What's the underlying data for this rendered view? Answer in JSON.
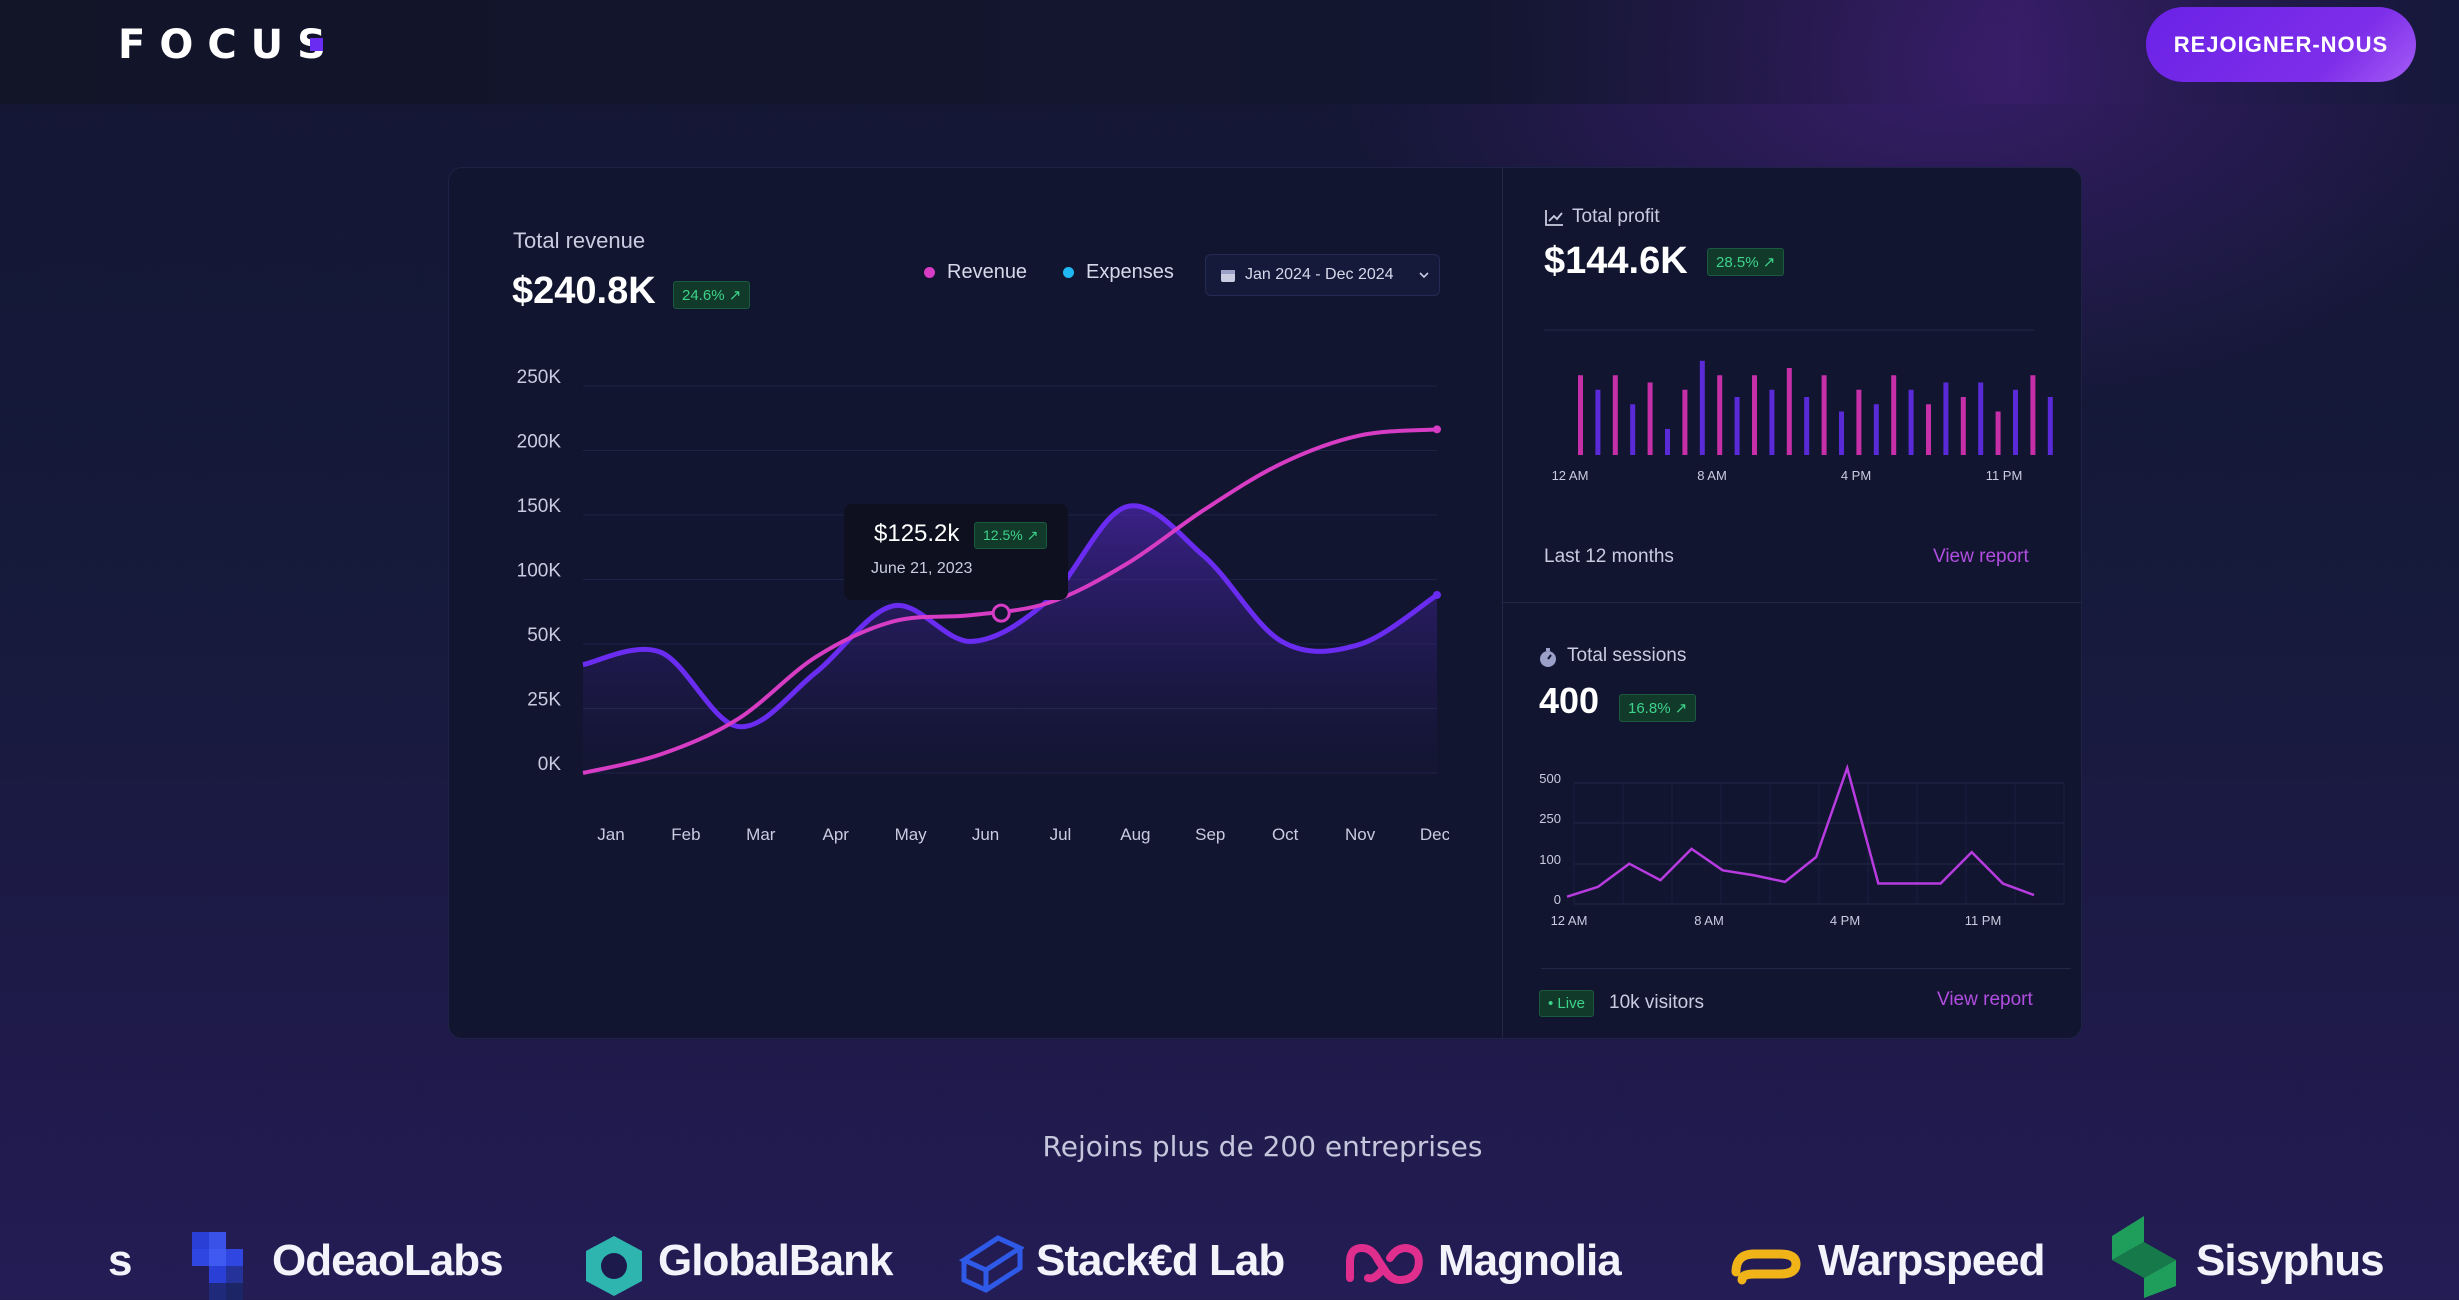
{
  "header": {
    "logo_text": "FOCUS",
    "cta_label": "REJOIGNER-NOUS"
  },
  "revenue": {
    "title": "Total revenue",
    "value": "$240.8K",
    "badge": "24.6% ↗",
    "legend": [
      {
        "name": "Revenue",
        "color": "#d63cc4"
      },
      {
        "name": "Expenses",
        "color": "#1fb8f2"
      }
    ],
    "date_range": "Jan 2024 - Dec 2024",
    "tooltip": {
      "value": "$125.2k",
      "badge": "12.5% ↗",
      "date": "June 21, 2023"
    }
  },
  "profit": {
    "title": "Total profit",
    "value": "$144.6K",
    "badge": "28.5% ↗",
    "footer": "Last 12 months",
    "link": "View report"
  },
  "sessions": {
    "title": "Total sessions",
    "value": "400",
    "badge": "16.8% ↗",
    "live_label": "• Live",
    "visitors": "10k visitors",
    "link": "View report"
  },
  "clients": {
    "subtitle": "Rejoins plus de 200 entreprises",
    "brands": [
      "s",
      "OdeaoLabs",
      "GlobalBank",
      "Stack€d Lab",
      "Magnolia",
      "Warpspeed",
      "Sisyphus"
    ]
  },
  "chart_data": [
    {
      "type": "line",
      "title": "",
      "categories": [
        "Jan",
        "Feb",
        "Mar",
        "Apr",
        "May",
        "Jun",
        "Jul",
        "Aug",
        "Sep",
        "Oct",
        "Nov",
        "Dec"
      ],
      "y_ticks": [
        "250K",
        "200K",
        "150K",
        "100K",
        "50K",
        "25K",
        "0K"
      ],
      "series": [
        {
          "name": "Revenue",
          "color": "#d63cc4",
          "values": [
            0,
            12,
            35,
            75,
            98,
            102,
            110,
            135,
            170,
            200,
            218,
            222
          ]
        },
        {
          "name": "Expenses",
          "color": "#6a2cf0",
          "values": [
            70,
            78,
            30,
            65,
            108,
            85,
            112,
            172,
            140,
            85,
            83,
            115
          ]
        }
      ]
    },
    {
      "type": "bar",
      "x_ticks": [
        "12 AM",
        "8 AM",
        "4 PM",
        "11 PM"
      ],
      "values": [
        55,
        45,
        55,
        35,
        50,
        18,
        45,
        65,
        55,
        40,
        55,
        45,
        60,
        40,
        55,
        30,
        45,
        35,
        55,
        45,
        35,
        50,
        40,
        50,
        30,
        45,
        55,
        40,
        55,
        45
      ]
    },
    {
      "type": "line",
      "x_ticks": [
        "12 AM",
        "8 AM",
        "4 PM",
        "11 PM"
      ],
      "y_ticks": [
        "500",
        "250",
        "100",
        "0"
      ],
      "values": [
        10,
        40,
        110,
        60,
        155,
        90,
        75,
        55,
        130,
        400,
        50,
        50,
        50,
        145,
        50,
        15
      ]
    }
  ]
}
